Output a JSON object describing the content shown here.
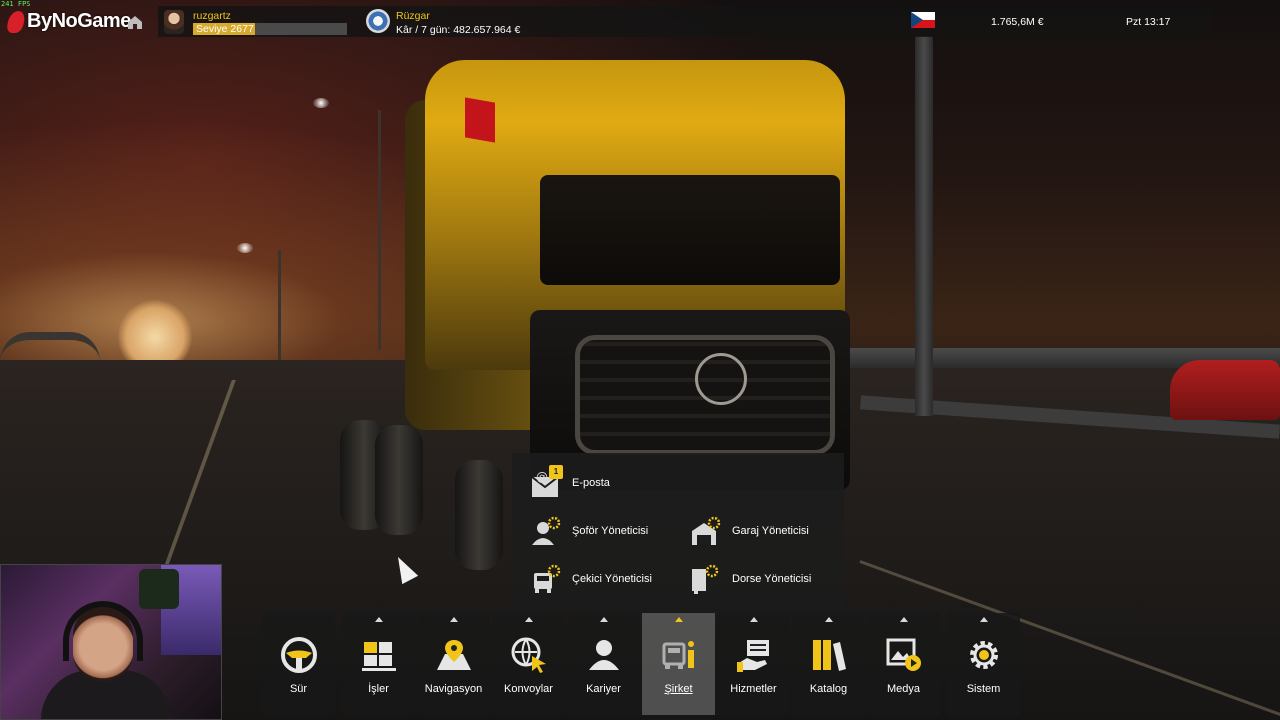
{
  "hud": {
    "fps": "241 FPS",
    "overlay_logo": "ByNoGame"
  },
  "topbar": {
    "username": "ruzgartz",
    "level": "Seviye 2677",
    "level_progress": 0.4,
    "company_name": "Rüzgar",
    "profit": "Kâr / 7 gün: 482.657.964 €",
    "country_flag": "czech-republic",
    "money": "1.765,6M  €",
    "time": "Pzt 13:17"
  },
  "submenu": {
    "email": {
      "label": "E-posta",
      "badge": "1"
    },
    "driver_manager": "Şoför Yöneticisi",
    "garage_manager": "Garaj Yöneticisi",
    "truck_manager": "Çekici Yöneticisi",
    "trailer_manager": "Dorse Yöneticisi"
  },
  "menu": {
    "items": [
      {
        "label": "Sür",
        "icon": "steering-wheel-icon"
      },
      {
        "label": "İşler",
        "icon": "cargo-icon"
      },
      {
        "label": "Navigasyon",
        "icon": "map-pin-icon"
      },
      {
        "label": "Konvoylar",
        "icon": "globe-cursor-icon"
      },
      {
        "label": "Kariyer",
        "icon": "person-icon"
      },
      {
        "label": "Şirket",
        "icon": "company-icon",
        "active": true
      },
      {
        "label": "Hizmetler",
        "icon": "services-icon"
      },
      {
        "label": "Katalog",
        "icon": "books-icon"
      },
      {
        "label": "Medya",
        "icon": "media-icon"
      },
      {
        "label": "Sistem",
        "icon": "gear-icon"
      }
    ]
  },
  "colors": {
    "accent": "#f0c419",
    "panel": "#1c1c1c",
    "active_panel": "#585858"
  }
}
